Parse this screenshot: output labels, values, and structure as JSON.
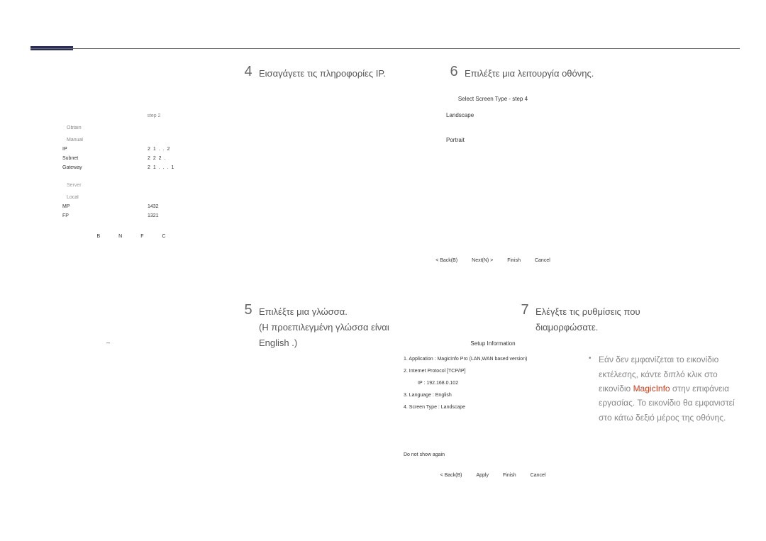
{
  "header": {},
  "steps": {
    "s4": {
      "num": "4",
      "text": "Εισαγάγετε τις πληροφορίες IP."
    },
    "s5": {
      "num": "5",
      "text_line1": "Επιλέξτε μια γλώσσα.",
      "text_line2": "(Η προεπιλεγμένη γλώσσα είναι",
      "text_line3": "English .)"
    },
    "s6": {
      "num": "6",
      "text": "Επιλέξτε μια λειτουργία οθόνης."
    },
    "s7": {
      "num": "7",
      "text_line1": "Ελέγξτε τις ρυθμίσεις που",
      "text_line2": "διαμορφώσατε."
    }
  },
  "ip_dialog": {
    "title": "step 2",
    "obtain_auto": "Obtain",
    "manual": "Manual",
    "ip_k": "IP",
    "ip_v": "2 1 .     . 2",
    "sm_k": "Subnet",
    "sm_v": "2 2 2 .",
    "gw_k": "Gateway",
    "gw_v": "2 1 .     .     . 1",
    "server_h": "Server",
    "local_h": "Local",
    "mp_k": "MP",
    "mp_v": "1432",
    "fp_k": "FP",
    "fp_v": "1321",
    "btn_back": "B",
    "btn_next": "N",
    "btn_finish": "F",
    "btn_cancel": "C"
  },
  "lang_dialog": {
    "dash": "–"
  },
  "screen_dialog": {
    "title": "Select Screen Type - step 4",
    "opt1": "Landscape",
    "opt2": "Portrait",
    "btn_back": "< Back(B)",
    "btn_next": "Next(N) >",
    "btn_finish": "Finish",
    "btn_cancel": "Cancel"
  },
  "summary_dialog": {
    "title": "Setup Information",
    "l1": "1. Application :    MagicInfo Pro (LAN,WAN based version)",
    "l2": "2. Internet Protocol [TCP/IP]",
    "l2ip": "IP :     192.168.0.102",
    "l3": "3. Language :    English",
    "l4": "4. Screen Type :    Landscape",
    "chk": "Do not show again",
    "btn_back": "< Back(B)",
    "btn_apply": "Apply",
    "btn_finish": "Finish",
    "btn_cancel": "Cancel"
  },
  "note7": {
    "text1": "Εάν δεν εμφανίζεται το εικονίδιο",
    "text2": "εκτέλεσης, κάντε διπλό κλικ στο",
    "text3a": "εικονίδιο ",
    "text3b": "MagicInfo",
    "text3c": "  στην επιφάνεια",
    "text4": "εργασίας. Το εικονίδιο θα εμφανιστεί",
    "text5": "στο κάτω δεξιό μέρος της οθόνης."
  }
}
